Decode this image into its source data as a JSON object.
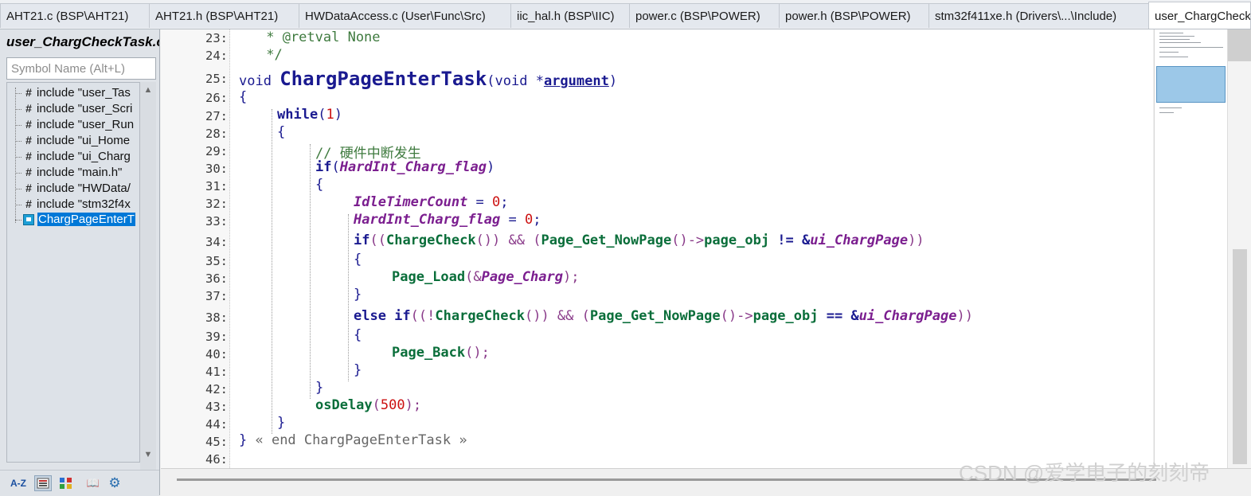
{
  "tabs": [
    {
      "label": "AHT21.c (BSP\\AHT21)"
    },
    {
      "label": "AHT21.h (BSP\\AHT21)"
    },
    {
      "label": "HWDataAccess.c (User\\Func\\Src)"
    },
    {
      "label": "iic_hal.h (BSP\\IIC)"
    },
    {
      "label": "power.c (BSP\\POWER)"
    },
    {
      "label": "power.h (BSP\\POWER)"
    },
    {
      "label": "stm32f411xe.h (Drivers\\...\\Include)"
    },
    {
      "label": "user_ChargCheckTask.c"
    }
  ],
  "left_panel": {
    "title": "user_ChargCheckTask.c",
    "search_placeholder": "Symbol Name (Alt+L)",
    "items": [
      {
        "label": "include \"user_Tas"
      },
      {
        "label": "include \"user_Scri"
      },
      {
        "label": "include \"user_Run"
      },
      {
        "label": "include \"ui_Home"
      },
      {
        "label": "include \"ui_Charg"
      },
      {
        "label": "include \"main.h\""
      },
      {
        "label": "include \"HWData/"
      },
      {
        "label": "include \"stm32f4x"
      },
      {
        "label": "ChargPageEnterT"
      }
    ],
    "toolbar": {
      "sort_label": "A-Z",
      "book_label": "📖",
      "settings_label": "⚙"
    }
  },
  "editor": {
    "line_numbers": [
      "23:",
      "24:",
      "25:",
      "26:",
      "27:",
      "28:",
      "29:",
      "30:",
      "31:",
      "32:",
      "33:",
      "34:",
      "35:",
      "36:",
      "37:",
      "38:",
      "39:",
      "40:",
      "41:",
      "42:",
      "43:",
      "44:",
      "45:",
      "46:"
    ],
    "tokens": {
      "l23": " * @retval None",
      "l24": " */",
      "l25_void": "void ",
      "l25_name": "ChargPageEnterTask",
      "l25_open": "(void *",
      "l25_arg": "argument",
      "l25_close": ")",
      "l26": "{",
      "l27_kw": "while",
      "l27_open": "(",
      "l27_num": "1",
      "l27_close": ")",
      "l28": "{",
      "l29": "// 硬件中断发生",
      "l30_kw": "if",
      "l30_open": "(",
      "l30_var": "HardInt_Charg_flag",
      "l30_close": ")",
      "l31": "{",
      "l32_var": "IdleTimerCount",
      "l32_eq": " = ",
      "l32_num": "0",
      "l32_end": ";",
      "l33_var": "HardInt_Charg_flag",
      "l33_eq": " = ",
      "l33_num": "0",
      "l33_end": ";",
      "l34_kw": "if",
      "l34_a": "((",
      "l34_fn1": "ChargeCheck",
      "l34_b": "()) && (",
      "l34_fn2": "Page_Get_NowPage",
      "l34_c": "()->",
      "l34_fn3": "page_obj",
      "l34_d": " != &",
      "l34_var": "ui_ChargPage",
      "l34_e": "))",
      "l35": "{",
      "l36_fn": "Page_Load",
      "l36_a": "(&",
      "l36_var": "Page_Charg",
      "l36_b": ");",
      "l37": "}",
      "l38_kw": "else if",
      "l38_a": "((!",
      "l38_fn1": "ChargeCheck",
      "l38_b": "()) && (",
      "l38_fn2": "Page_Get_NowPage",
      "l38_c": "()->",
      "l38_fn3": "page_obj",
      "l38_d": " == &",
      "l38_var": "ui_ChargPage",
      "l38_e": "))",
      "l39": "{",
      "l40_fn": "Page_Back",
      "l40_a": "();",
      "l41": "}",
      "l42": "}",
      "l43_fn": "osDelay",
      "l43_a": "(",
      "l43_num": "500",
      "l43_b": ");",
      "l44": "}",
      "l45_brace": "}",
      "l45_end": " « end ChargPageEnterTask »"
    }
  },
  "watermark": "CSDN @爱学电子的刻刻帝"
}
